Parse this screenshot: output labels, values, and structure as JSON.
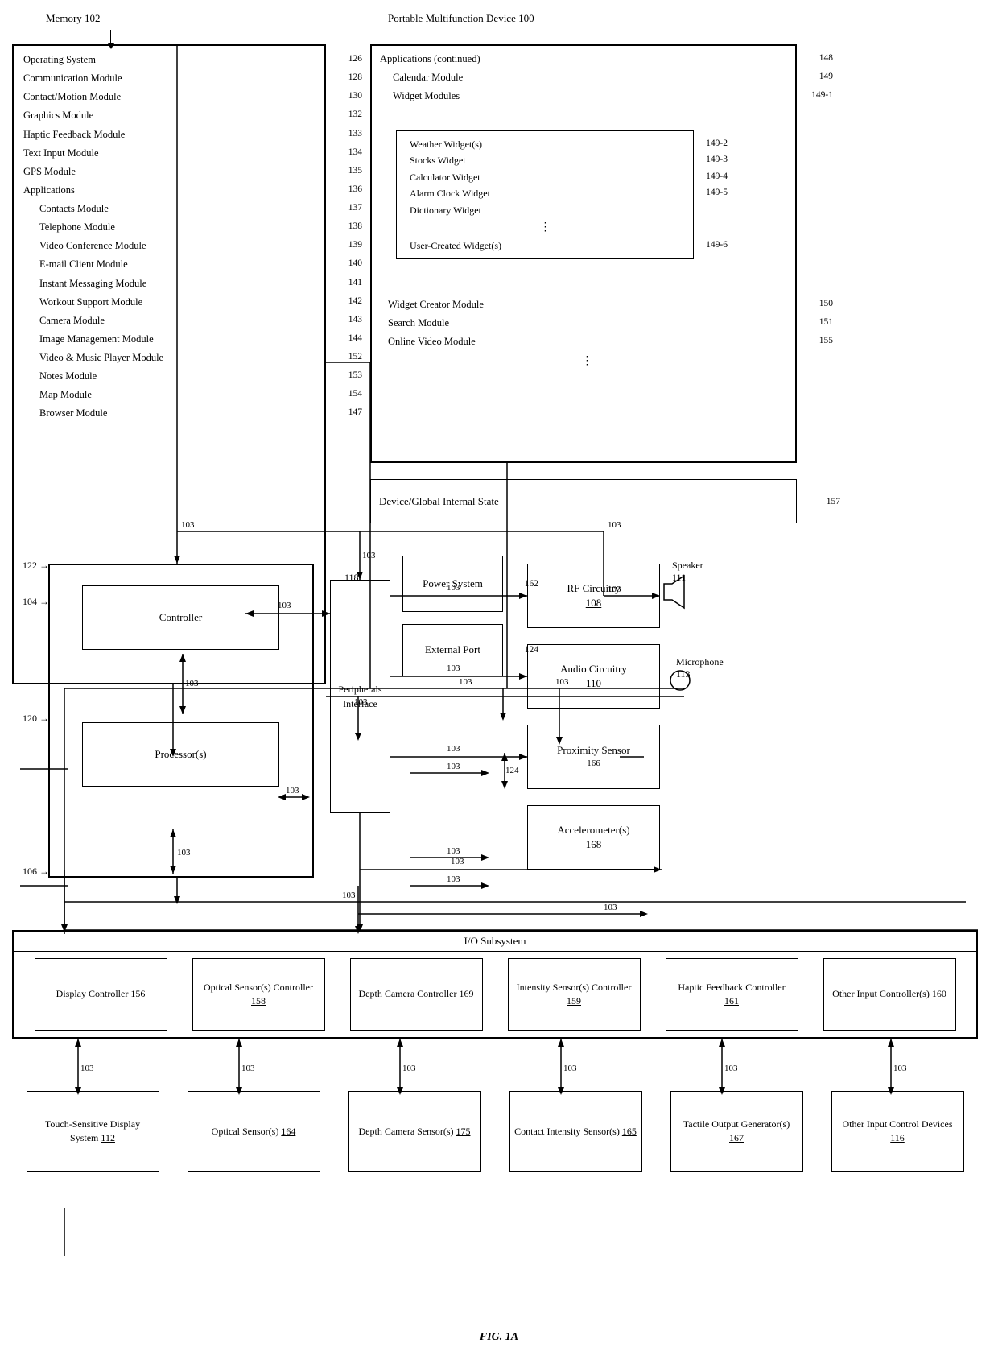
{
  "title": "FIG. 1A",
  "memory": {
    "label": "Memory",
    "ref": "102",
    "items": [
      {
        "text": "Operating System",
        "ref": "126"
      },
      {
        "text": "Communication Module",
        "ref": "128"
      },
      {
        "text": "Contact/Motion Module",
        "ref": "130"
      },
      {
        "text": "Graphics Module",
        "ref": "132"
      },
      {
        "text": "Haptic Feedback Module",
        "ref": "133"
      },
      {
        "text": "Text Input Module",
        "ref": "134"
      },
      {
        "text": "GPS Module",
        "ref": "135"
      },
      {
        "text": "Applications",
        "ref": "136"
      },
      {
        "text": "Contacts Module",
        "ref": "137",
        "sub": true
      },
      {
        "text": "Telephone Module",
        "ref": "138",
        "sub": true
      },
      {
        "text": "Video Conference Module",
        "ref": "139",
        "sub": true
      },
      {
        "text": "E-mail Client Module",
        "ref": "140",
        "sub": true
      },
      {
        "text": "Instant Messaging Module",
        "ref": "141",
        "sub": true
      },
      {
        "text": "Workout Support Module",
        "ref": "142",
        "sub": true
      },
      {
        "text": "Camera Module",
        "ref": "143",
        "sub": true
      },
      {
        "text": "Image Management Module",
        "ref": "144",
        "sub": true
      },
      {
        "text": "Video & Music Player Module",
        "ref": "152",
        "sub": true
      },
      {
        "text": "Notes Module",
        "ref": "153",
        "sub": true
      },
      {
        "text": "Map Module",
        "ref": "154",
        "sub": true
      },
      {
        "text": "Browser Module",
        "ref": "147",
        "sub": true
      }
    ]
  },
  "pmd": {
    "label": "Portable Multifunction Device",
    "ref": "100",
    "items": [
      {
        "text": "Applications (continued)",
        "ref": "148"
      },
      {
        "text": "Calendar Module",
        "ref": "149"
      },
      {
        "text": "Widget Modules",
        "ref": "149-1"
      },
      {
        "text": "Weather Widget(s)",
        "ref": "149-2",
        "sub": true
      },
      {
        "text": "Stocks Widget",
        "ref": "149-3",
        "sub": true
      },
      {
        "text": "Calculator Widget",
        "ref": "149-4",
        "sub": true
      },
      {
        "text": "Alarm Clock Widget",
        "ref": "149-5",
        "sub": true
      },
      {
        "text": "Dictionary Widget",
        "ref": null,
        "sub": true
      },
      {
        "text": "...",
        "ref": null,
        "sub": true
      },
      {
        "text": "User-Created Widget(s)",
        "ref": "149-6",
        "sub": true
      },
      {
        "text": "Widget Creator Module",
        "ref": "150"
      },
      {
        "text": "Search Module",
        "ref": "151"
      },
      {
        "text": "Online Video Module",
        "ref": "155"
      },
      {
        "text": "...",
        "ref": null
      },
      {
        "text": "Device/Global Internal State",
        "ref": "157"
      }
    ]
  },
  "powerSystem": {
    "label": "Power System",
    "ref": "162"
  },
  "externalPort": {
    "label": "External Port",
    "ref": "124"
  },
  "rfCircuitry": {
    "label": "RF Circuitry\n108",
    "ref": "108"
  },
  "audioCircuitry": {
    "label": "Audio Circuitry\n110",
    "ref": "110"
  },
  "proximitySensor": {
    "label": "Proximity Sensor",
    "ref": "166"
  },
  "accelerometers": {
    "label": "Accelerometer(s)\n168",
    "ref": "168"
  },
  "speaker": {
    "label": "Speaker\n111",
    "ref": "111"
  },
  "microphone": {
    "label": "Microphone\n113",
    "ref": "113"
  },
  "controller": {
    "label": "Controller",
    "ref": "104"
  },
  "processor": {
    "label": "Processor(s)",
    "ref": "120"
  },
  "peripheralsInterface": {
    "label": "Peripherals Interface",
    "ref": "118"
  },
  "ioSubsystem": {
    "label": "I/O Subsystem"
  },
  "ioItems": [
    {
      "label": "Display Controller 156",
      "ref": "156"
    },
    {
      "label": "Optical Sensor(s) Controller 158",
      "ref": "158"
    },
    {
      "label": "Depth Camera Controller 169",
      "ref": "169"
    },
    {
      "label": "Intensity Sensor(s) Controller 159",
      "ref": "159"
    },
    {
      "label": "Haptic Feedback Controller 161",
      "ref": "161"
    },
    {
      "label": "Other Input Controller(s) 160",
      "ref": "160"
    }
  ],
  "bottomItems": [
    {
      "label": "Touch-Sensitive Display System\n112",
      "ref": "112"
    },
    {
      "label": "Optical Sensor(s)\n164",
      "ref": "164"
    },
    {
      "label": "Depth Camera Sensor(s)\n175",
      "ref": "175"
    },
    {
      "label": "Contact Intensity Sensor(s)\n165",
      "ref": "165"
    },
    {
      "label": "Tactile Output Generator(s)\n167",
      "ref": "167"
    },
    {
      "label": "Other Input Control Devices\n116",
      "ref": "116"
    }
  ],
  "busRef": "103",
  "controllerRef": "104",
  "processorRef": "120",
  "controllerBoxRef": "122",
  "processorBoxRef": "106"
}
